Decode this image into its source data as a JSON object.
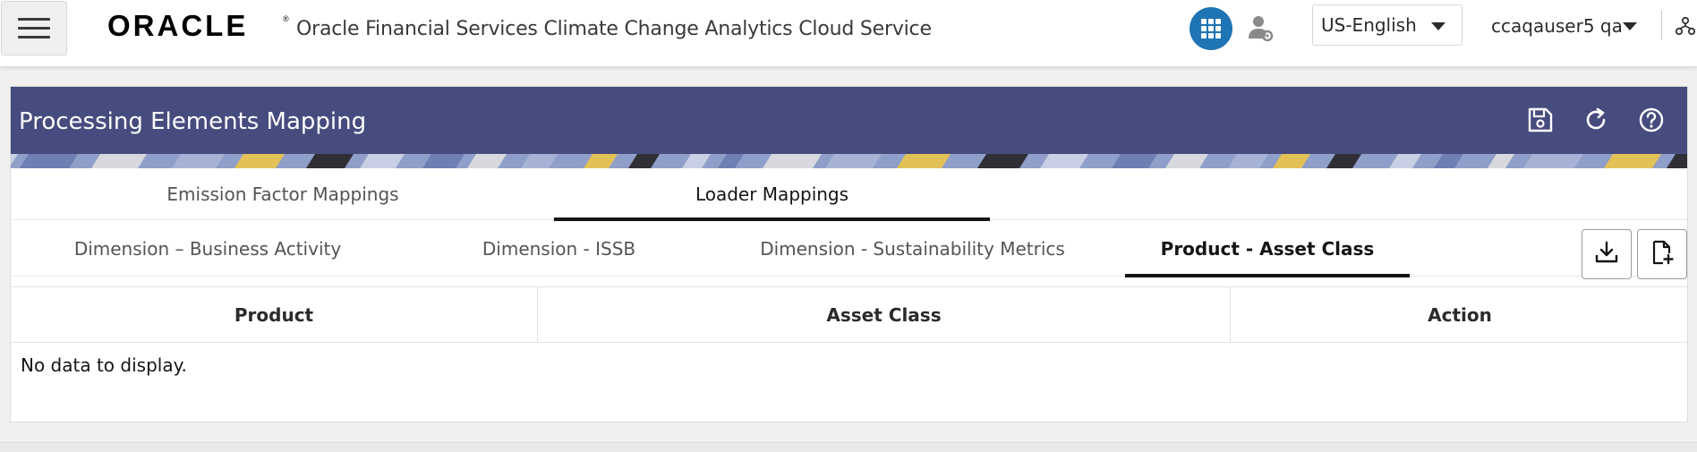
{
  "header": {
    "menu_icon": "hamburger-menu-icon",
    "brand": "ORACLE",
    "app_title": "Oracle Financial Services Climate Change Analytics Cloud Service",
    "apps_icon": "grid-apps-icon",
    "user_settings_icon": "user-gear-icon",
    "language": "US-English",
    "user_name": "ccaqauser5 qa",
    "extra_icon": "hierarchy-icon",
    "accent_color": "#1f74b4"
  },
  "page": {
    "title": "Processing Elements Mapping",
    "header_color": "#464c7e",
    "icons": [
      "save-icon",
      "refresh-icon",
      "help-icon"
    ]
  },
  "tabs_primary": [
    {
      "label": "Emission Factor Mappings",
      "active": false
    },
    {
      "label": "Loader Mappings",
      "active": true
    }
  ],
  "tabs_secondary": [
    {
      "label": "Dimension – Business Activity",
      "active": false
    },
    {
      "label": "Dimension - ISSB",
      "active": false
    },
    {
      "label": "Dimension - Sustainability Metrics",
      "active": false
    },
    {
      "label": "Product - Asset Class",
      "active": true
    }
  ],
  "toolbar": {
    "icons": [
      "download-icon",
      "add-file-icon"
    ]
  },
  "table": {
    "columns": [
      "Product",
      "Asset Class",
      "Action"
    ],
    "rows": [],
    "empty_message": "No data to display."
  }
}
